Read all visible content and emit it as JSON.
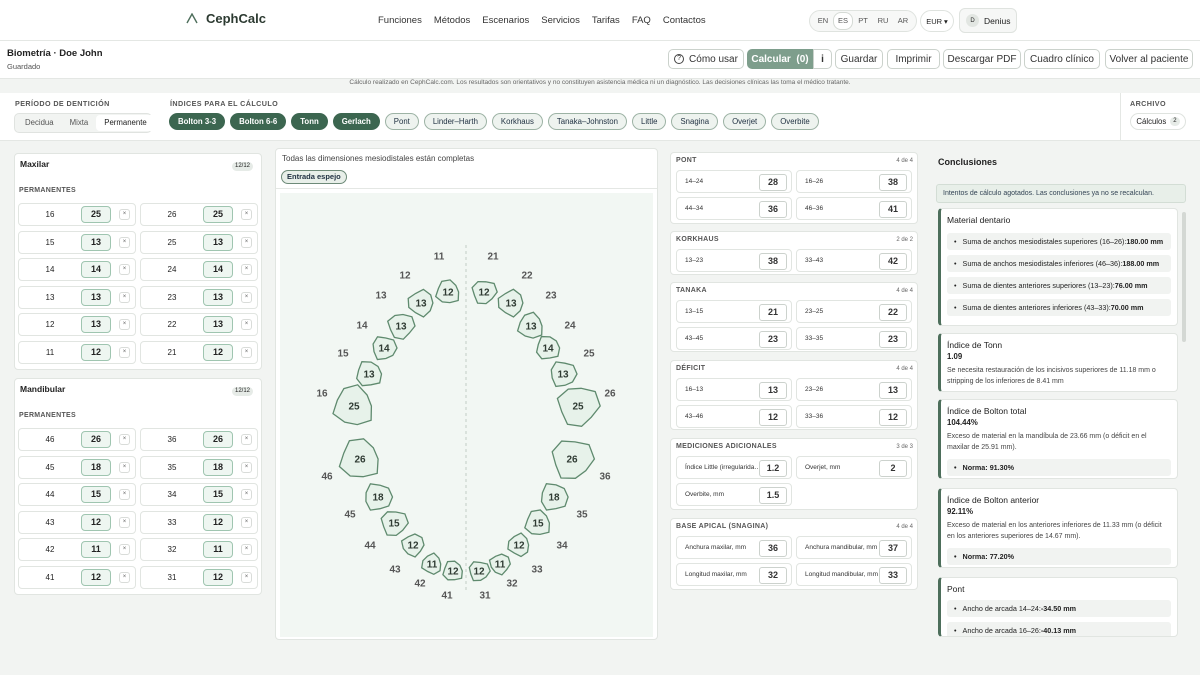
{
  "nav": {
    "brand": "CephCalc",
    "links": [
      "Funciones",
      "Métodos",
      "Escenarios",
      "Servicios",
      "Tarifas",
      "FAQ",
      "Contactos"
    ],
    "languages": [
      "EN",
      "ES",
      "PT",
      "RU",
      "AR"
    ],
    "active_language": "ES",
    "currency": "EUR",
    "user_initial": "D",
    "user_name": "Denius"
  },
  "header": {
    "title": "Biometría · Doe John",
    "status": "Guardado",
    "buttons": {
      "how": "Cómo usar",
      "calc": "Calcular",
      "calc_count": "(0)",
      "info": "i",
      "save": "Guardar",
      "print": "Imprimir",
      "pdf": "Descargar PDF",
      "clinical": "Cuadro clínico",
      "back": "Volver al paciente"
    }
  },
  "disclaimer": "Cálculo realizado en CephCalc.com. Los resultados son orientativos y no constituyen asistencia médica ni un diagnóstico. Las decisiones clínicas las toma el médico tratante.",
  "dentition": {
    "label": "PERÍODO DE DENTICIÓN",
    "options": [
      "Decidua",
      "Mixta",
      "Permanente"
    ],
    "selected": "Permanente"
  },
  "indices": {
    "label": "ÍNDICES PARA EL CÁLCULO",
    "items": [
      {
        "name": "Bolton 3-3",
        "on": true
      },
      {
        "name": "Bolton 6-6",
        "on": true
      },
      {
        "name": "Tonn",
        "on": true
      },
      {
        "name": "Gerlach",
        "on": true
      },
      {
        "name": "Pont",
        "on": false
      },
      {
        "name": "Linder–Harth",
        "on": false
      },
      {
        "name": "Korkhaus",
        "on": false
      },
      {
        "name": "Tanaka–Johnston",
        "on": false
      },
      {
        "name": "Little",
        "on": false
      },
      {
        "name": "Snagina",
        "on": false
      },
      {
        "name": "Overjet",
        "on": false
      },
      {
        "name": "Overbite",
        "on": false
      }
    ]
  },
  "archive": {
    "label": "ARCHIVO",
    "button": "Cálculos",
    "count": "2"
  },
  "maxilar": {
    "title": "Maxilar",
    "count": "12/12",
    "section": "PERMANENTES",
    "rows": [
      {
        "a": "16",
        "av": "25",
        "b": "26",
        "bv": "25"
      },
      {
        "a": "15",
        "av": "13",
        "b": "25",
        "bv": "13"
      },
      {
        "a": "14",
        "av": "14",
        "b": "24",
        "bv": "14"
      },
      {
        "a": "13",
        "av": "13",
        "b": "23",
        "bv": "13"
      },
      {
        "a": "12",
        "av": "13",
        "b": "22",
        "bv": "13"
      },
      {
        "a": "11",
        "av": "12",
        "b": "21",
        "bv": "12"
      }
    ]
  },
  "mandibular": {
    "title": "Mandibular",
    "count": "12/12",
    "section": "PERMANENTES",
    "rows": [
      {
        "a": "46",
        "av": "26",
        "b": "36",
        "bv": "26"
      },
      {
        "a": "45",
        "av": "18",
        "b": "35",
        "bv": "18"
      },
      {
        "a": "44",
        "av": "15",
        "b": "34",
        "bv": "15"
      },
      {
        "a": "43",
        "av": "12",
        "b": "33",
        "bv": "12"
      },
      {
        "a": "42",
        "av": "11",
        "b": "32",
        "bv": "11"
      },
      {
        "a": "41",
        "av": "12",
        "b": "31",
        "bv": "12"
      }
    ]
  },
  "remove_symbol": "×",
  "chart_center": {
    "status": "Todas las dimensiones mesiodistales están completas",
    "mirror": "Entrada espejo",
    "upper": [
      {
        "n": "11",
        "v": "12"
      },
      {
        "n": "12",
        "v": "13"
      },
      {
        "n": "13",
        "v": "13"
      },
      {
        "n": "14",
        "v": "14"
      },
      {
        "n": "15",
        "v": "13"
      },
      {
        "n": "16",
        "v": "25"
      },
      {
        "n": "21",
        "v": "12"
      },
      {
        "n": "22",
        "v": "13"
      },
      {
        "n": "23",
        "v": "13"
      },
      {
        "n": "24",
        "v": "14"
      },
      {
        "n": "25",
        "v": "13"
      },
      {
        "n": "26",
        "v": "25"
      }
    ],
    "lower": [
      {
        "n": "46",
        "v": "26"
      },
      {
        "n": "45",
        "v": "18"
      },
      {
        "n": "44",
        "v": "15"
      },
      {
        "n": "43",
        "v": "12"
      },
      {
        "n": "42",
        "v": "11"
      },
      {
        "n": "41",
        "v": "12"
      },
      {
        "n": "31",
        "v": "12"
      },
      {
        "n": "32",
        "v": "11"
      },
      {
        "n": "33",
        "v": "12"
      },
      {
        "n": "34",
        "v": "15"
      },
      {
        "n": "35",
        "v": "18"
      },
      {
        "n": "36",
        "v": "26"
      }
    ]
  },
  "measures": {
    "pont": {
      "title": "PONT",
      "count": "4 de 4",
      "items": [
        {
          "l": "14–24",
          "v": "28"
        },
        {
          "l": "16–26",
          "v": "38"
        },
        {
          "l": "44–34",
          "v": "36"
        },
        {
          "l": "46–36",
          "v": "41"
        }
      ]
    },
    "korkhaus": {
      "title": "KORKHAUS",
      "count": "2 de 2",
      "items": [
        {
          "l": "13–23",
          "v": "38"
        },
        {
          "l": "33–43",
          "v": "42"
        }
      ]
    },
    "tanaka": {
      "title": "TANAKA",
      "count": "4 de 4",
      "items": [
        {
          "l": "13–15",
          "v": "21"
        },
        {
          "l": "23–25",
          "v": "22"
        },
        {
          "l": "43–45",
          "v": "23"
        },
        {
          "l": "33–35",
          "v": "23"
        }
      ]
    },
    "deficit": {
      "title": "DÉFICIT",
      "count": "4 de 4",
      "items": [
        {
          "l": "16–13",
          "v": "13"
        },
        {
          "l": "23–26",
          "v": "13"
        },
        {
          "l": "43–46",
          "v": "12"
        },
        {
          "l": "33–36",
          "v": "12"
        }
      ]
    },
    "additional": {
      "title": "MEDICIONES ADICIONALES",
      "count": "3 de 3",
      "items": [
        {
          "l": "Índice Little (irregularida…",
          "v": "1.2"
        },
        {
          "l": "Overjet, mm",
          "v": "2"
        },
        {
          "l": "Overbite, mm",
          "v": "1.5"
        }
      ]
    },
    "base": {
      "title": "BASE APICAL (SNAGINA)",
      "count": "4 de 4",
      "items": [
        {
          "l": "Anchura maxilar, mm",
          "v": "36"
        },
        {
          "l": "Anchura mandibular, mm",
          "v": "37"
        },
        {
          "l": "Longitud maxilar, mm",
          "v": "32"
        },
        {
          "l": "Longitud mandibular, mm",
          "v": "33"
        }
      ]
    }
  },
  "conclusions": {
    "title": "Conclusiones",
    "notice": "Intentos de cálculo agotados. Las conclusiones ya no se recalculan.",
    "material": {
      "title": "Material dentario",
      "items": [
        {
          "t": "Suma de anchos mesiodistales superiores (16–26): ",
          "v": "180.00 mm"
        },
        {
          "t": "Suma de anchos mesiodistales inferiores (46–36): ",
          "v": "188.00 mm"
        },
        {
          "t": "Suma de dientes anteriores superiores (13–23): ",
          "v": "76.00 mm"
        },
        {
          "t": "Suma de dientes anteriores inferiores (43–33): ",
          "v": "70.00 mm"
        }
      ]
    },
    "tonn": {
      "title": "Índice de Tonn",
      "value": "1.09",
      "text": "Se necesita restauración de los incisivos superiores de 11.18 mm o stripping de los inferiores de 8.41 mm"
    },
    "bolton_total": {
      "title": "Índice de Bolton total",
      "value": "104.44%",
      "text": "Exceso de material en la mandíbula de 23.66 mm (o déficit en el maxilar de 25.91 mm).",
      "norm": "Norma: 91.30%"
    },
    "bolton_ant": {
      "title": "Índice de Bolton anterior",
      "value": "92.11%",
      "text": "Exceso de material en los anteriores inferiores de 11.33 mm (o déficit en los anteriores superiores de 14.67 mm).",
      "norm": "Norma: 77.20%"
    },
    "pont": {
      "title": "Pont",
      "items": [
        {
          "t": "Ancho de arcada 14–24: ",
          "v": "-34.50 mm"
        },
        {
          "t": "Ancho de arcada 16–26: ",
          "v": "-40.13 mm"
        }
      ]
    }
  }
}
